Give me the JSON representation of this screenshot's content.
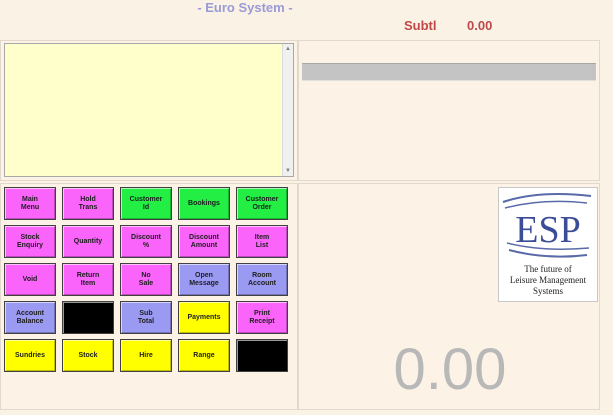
{
  "app": {
    "title": "- Euro System -",
    "subtotal_label": "Subtl",
    "subtotal_value": "0.00"
  },
  "display": {
    "total": "0.00"
  },
  "logo": {
    "letters": "ESP",
    "tagline_1": "The future of",
    "tagline_2": "Leisure Management",
    "tagline_3": "Systems"
  },
  "colors": {
    "pink": "#fa64fa",
    "green": "#22ee44",
    "blue": "#9a9af2",
    "yellow": "#ffff00",
    "black": "#000000"
  },
  "keypad": {
    "main_menu": "Main\nMenu",
    "hold_trans": "Hold\nTrans",
    "customer_id": "Customer\nId",
    "bookings": "Bookings",
    "customer_order": "Customer\nOrder",
    "stock_enquiry": "Stock\nEnquiry",
    "quantity": "Quantity",
    "discount_pct": "Discount\n%",
    "discount_amount": "Discount\nAmount",
    "item_list": "Item\nList",
    "void": "Void",
    "return_item": "Return\nItem",
    "no_sale": "No\nSale",
    "open_message": "Open\nMessage",
    "room_account": "Room\nAccount",
    "account_balance": "Account\nBalance",
    "sub_total": "Sub\nTotal",
    "payments": "Payments",
    "print_receipt": "Print\nReceipt",
    "sundries": "Sundries",
    "stock": "Stock",
    "hire": "Hire",
    "range": "Range"
  }
}
